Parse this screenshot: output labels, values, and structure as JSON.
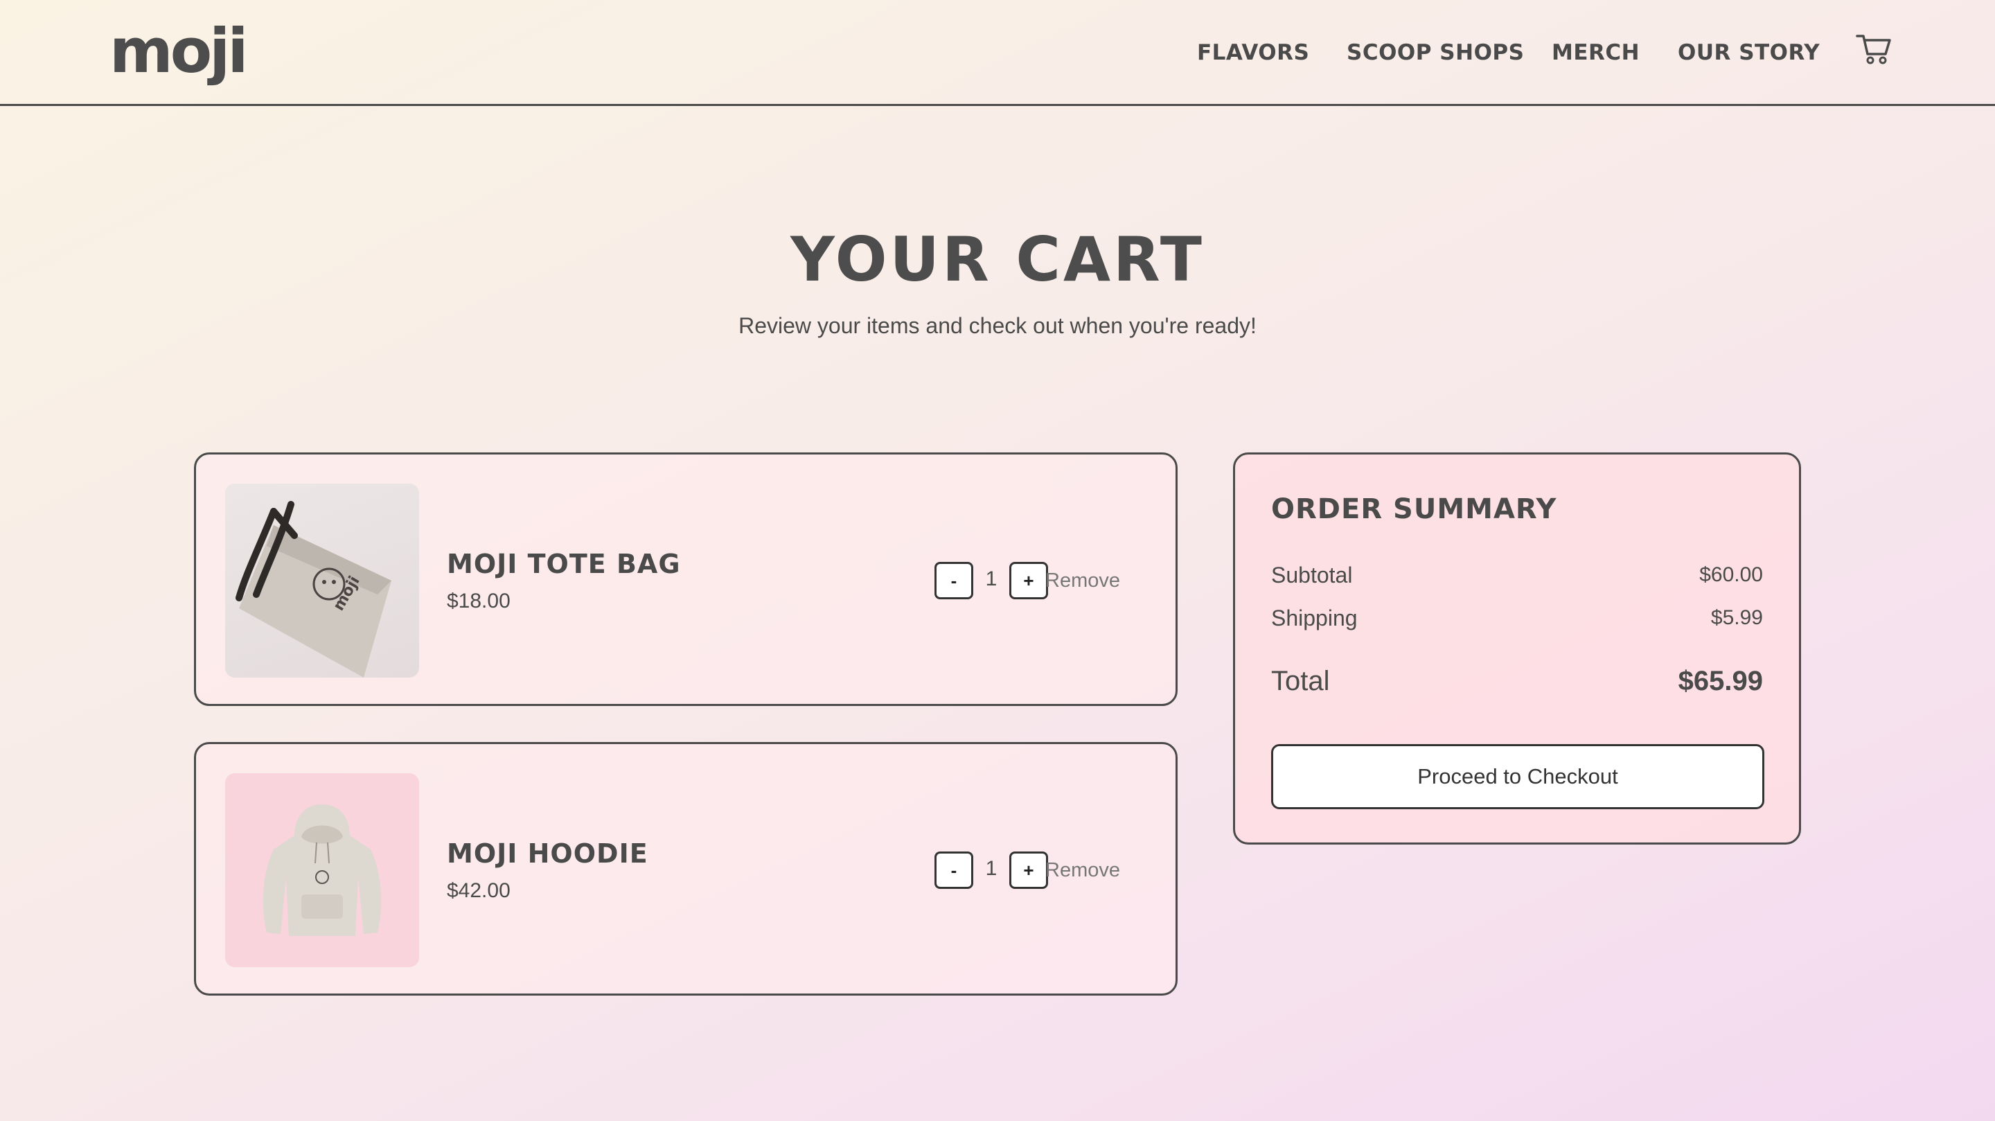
{
  "brand": {
    "logo_text": "moji"
  },
  "nav": {
    "items": [
      {
        "label": "FLAVORS"
      },
      {
        "label": "SCOOP SHOPS"
      },
      {
        "label": "MERCH"
      },
      {
        "label": "OUR STORY"
      }
    ],
    "cart_icon": "shopping-cart-icon"
  },
  "page": {
    "title": "YOUR CART",
    "subtitle": "Review your items and check out when you're ready!"
  },
  "cart": {
    "items": [
      {
        "name": "MOJI TOTE BAG",
        "price": "$18.00",
        "quantity": "1",
        "image_icon": "tote-bag-image",
        "minus_label": "-",
        "plus_label": "+",
        "remove_label": "Remove"
      },
      {
        "name": "MOJI HOODIE",
        "price": "$42.00",
        "quantity": "1",
        "image_icon": "hoodie-image",
        "minus_label": "-",
        "plus_label": "+",
        "remove_label": "Remove"
      }
    ]
  },
  "summary": {
    "title": "ORDER SUMMARY",
    "subtotal_label": "Subtotal",
    "subtotal_value": "$60.00",
    "shipping_label": "Shipping",
    "shipping_value": "$5.99",
    "total_label": "Total",
    "total_value": "$65.99",
    "checkout_label": "Proceed to Checkout"
  },
  "colors": {
    "text": "#4a4a4a",
    "border": "#4a4a4a",
    "card_bg": "#ffebee",
    "hoodie_thumb_bg": "#f9d4dd",
    "gradient_start": "#faf3e4",
    "gradient_end": "#f3d9f0"
  }
}
